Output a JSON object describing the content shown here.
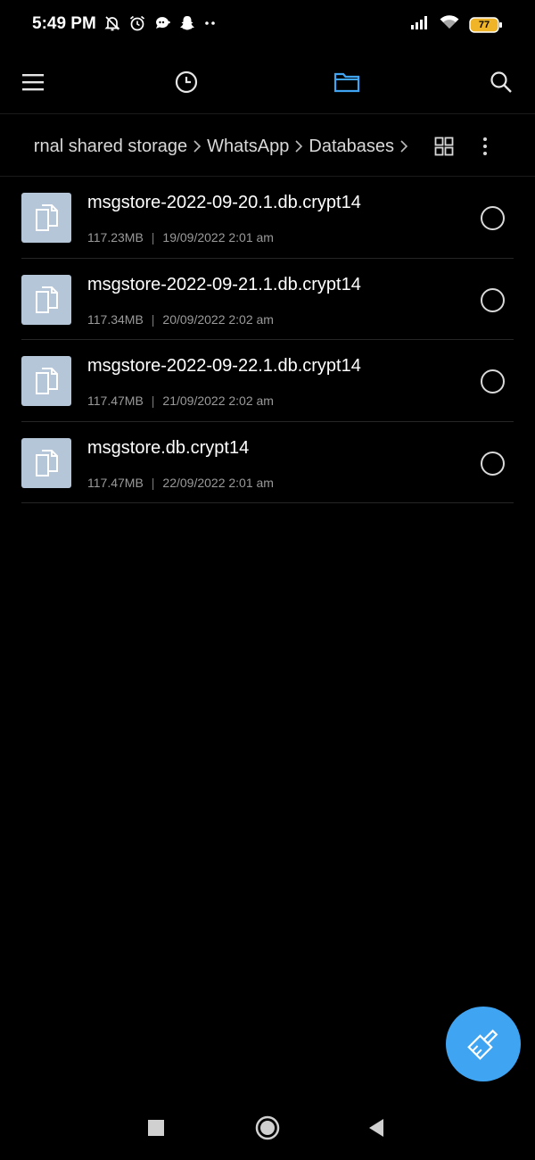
{
  "status_bar": {
    "time": "5:49 PM",
    "battery": "77",
    "left_icons": [
      "bell-off-icon",
      "alarm-icon",
      "chat-bubble-icon",
      "snapchat-icon",
      "more-dots-icon"
    ],
    "right_icons": [
      "signal-icon",
      "wifi-icon",
      "battery-icon"
    ]
  },
  "toolbar": {
    "icons": [
      "menu-icon",
      "history-clock-icon",
      "folder-icon",
      "search-icon"
    ],
    "active_tab": "folder-icon",
    "accent_color": "#3fa4f2"
  },
  "breadcrumb": {
    "segments": [
      "rnal shared storage",
      "WhatsApp",
      "Databases"
    ]
  },
  "actions": {
    "view_icon": "grid-view-icon",
    "more_icon": "more-vertical-icon"
  },
  "files": [
    {
      "name": "msgstore-2022-09-20.1.db.crypt14",
      "size": "117.23MB",
      "separator": "|",
      "date": "19/09/2022 2:01 am"
    },
    {
      "name": "msgstore-2022-09-21.1.db.crypt14",
      "size": "117.34MB",
      "separator": "|",
      "date": "20/09/2022 2:02 am"
    },
    {
      "name": "msgstore-2022-09-22.1.db.crypt14",
      "size": "117.47MB",
      "separator": "|",
      "date": "21/09/2022 2:02 am"
    },
    {
      "name": "msgstore.db.crypt14",
      "size": "117.47MB",
      "separator": "|",
      "date": "22/09/2022 2:01 am"
    }
  ],
  "fab": {
    "icon": "broom-clean-icon",
    "color": "#3fa4f2"
  },
  "nav_bar": {
    "icons": [
      "recents-square-icon",
      "home-circle-icon",
      "back-triangle-icon"
    ]
  }
}
